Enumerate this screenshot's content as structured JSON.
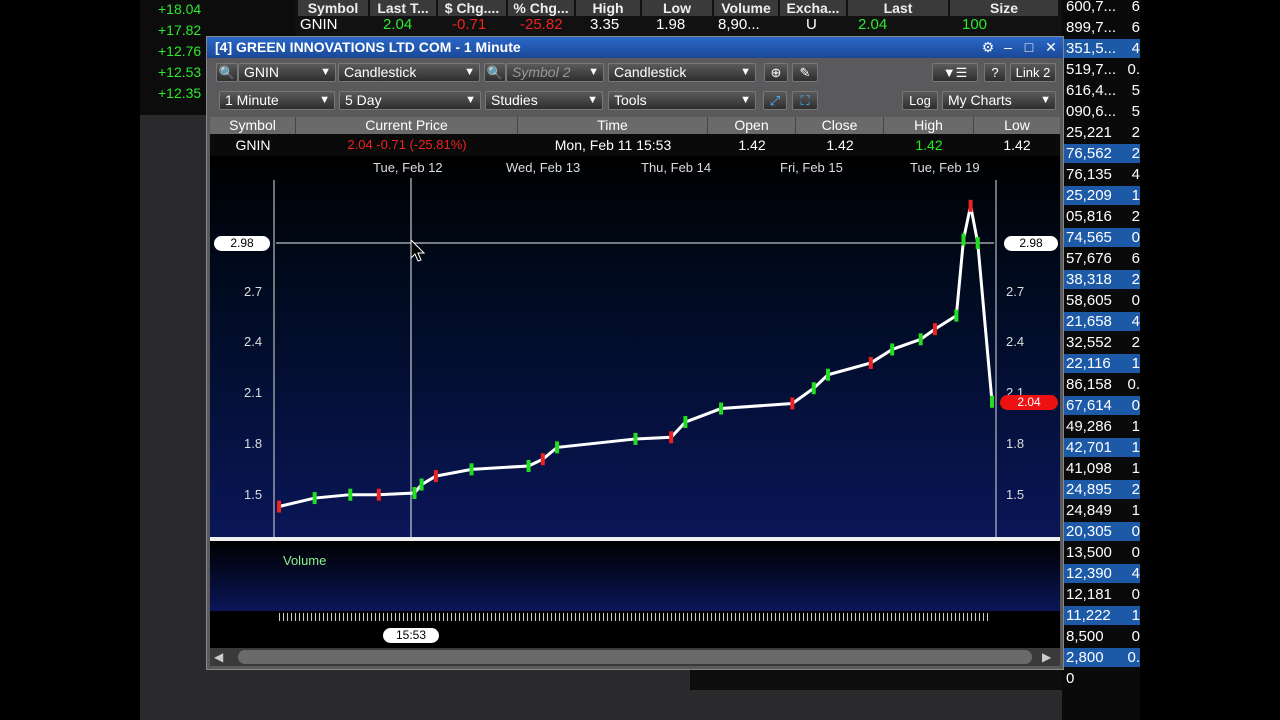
{
  "left_panel": {
    "values": [
      "+18.04",
      "+17.82",
      "+12.76",
      "+12.53",
      "+12.35"
    ]
  },
  "top_table": {
    "headers": [
      "Symbol",
      "Last T...",
      "$ Chg....",
      "% Chg...",
      "High",
      "Low",
      "Volume",
      "Excha...",
      "Last",
      "Size"
    ],
    "row": {
      "symbol": "GNIN",
      "last": "2.04",
      "chg": "-0.71",
      "pct": "-25.82",
      "high": "3.35",
      "low": "1.98",
      "volume": "8,90...",
      "exchange": "U",
      "last2": "2.04",
      "size": "100"
    }
  },
  "right_panel": {
    "rows": [
      {
        "n": "600,7...",
        "d": "6"
      },
      {
        "n": "899,7...",
        "d": "6"
      },
      {
        "n": "351,5...",
        "d": "4"
      },
      {
        "n": "519,7...",
        "d": "0."
      },
      {
        "n": "616,4...",
        "d": "5"
      },
      {
        "n": "090,6...",
        "d": "5"
      },
      {
        "n": "25,221",
        "d": "2"
      },
      {
        "n": "76,562",
        "d": "2"
      },
      {
        "n": "76,135",
        "d": "4"
      },
      {
        "n": "25,209",
        "d": "1"
      },
      {
        "n": "05,816",
        "d": "2"
      },
      {
        "n": "74,565",
        "d": "0"
      },
      {
        "n": "57,676",
        "d": "6"
      },
      {
        "n": "38,318",
        "d": "2"
      },
      {
        "n": "58,605",
        "d": "0"
      },
      {
        "n": "21,658",
        "d": "4"
      },
      {
        "n": "32,552",
        "d": "2"
      },
      {
        "n": "22,116",
        "d": "1"
      },
      {
        "n": "86,158",
        "d": "0."
      },
      {
        "n": "67,614",
        "d": "0"
      },
      {
        "n": "49,286",
        "d": "1"
      },
      {
        "n": "42,701",
        "d": "1"
      },
      {
        "n": "41,098",
        "d": "1"
      },
      {
        "n": "24,895",
        "d": "2"
      },
      {
        "n": "24,849",
        "d": "1"
      },
      {
        "n": "20,305",
        "d": "0"
      },
      {
        "n": "13,500",
        "d": "0"
      },
      {
        "n": "12,390",
        "d": "4"
      },
      {
        "n": "12,181",
        "d": "0"
      },
      {
        "n": "11,222",
        "d": "1"
      },
      {
        "n": "8,500",
        "d": "0"
      },
      {
        "n": "2,800",
        "d": "0."
      },
      {
        "n": "0",
        "d": ""
      }
    ]
  },
  "window": {
    "title": "[4] GREEN INNOVATIONS LTD COM - 1 Minute",
    "toolbar1": {
      "symbol": "GNIN",
      "chart_type": "Candlestick",
      "symbol2_placeholder": "Symbol 2",
      "chart_type2": "Candlestick",
      "link": "Link 2",
      "help": "?"
    },
    "toolbar2": {
      "interval": "1 Minute",
      "range": "5 Day",
      "studies": "Studies",
      "tools": "Tools",
      "log": "Log",
      "mycharts": "My Charts"
    },
    "quote": {
      "headers": [
        "Symbol",
        "Current Price",
        "Time",
        "Open",
        "Close",
        "High",
        "Low"
      ],
      "symbol": "GNIN",
      "current_price": "2.04  -0.71 (-25.81%)",
      "time": "Mon, Feb 11  15:53",
      "open": "1.42",
      "close": "1.42",
      "high": "1.42",
      "low": "1.42"
    },
    "dates": [
      "Tue, Feb 12",
      "Wed, Feb 13",
      "Thu, Feb 14",
      "Fri, Feb 15",
      "Tue, Feb 19"
    ],
    "price_ticks": [
      "2.7",
      "2.4",
      "2.1",
      "1.8",
      "1.5"
    ],
    "crosshair_price": "2.98",
    "last_price_badge": "2.04",
    "volume_label": "Volume",
    "crosshair_time": "15:53",
    "colors": {
      "up": "#22dd22",
      "down": "#ee2222",
      "badge": "#ee1111"
    }
  },
  "chart_data": {
    "type": "line",
    "title": "",
    "x": [
      "Tue, Feb 12",
      "Wed, Feb 13",
      "Thu, Feb 14",
      "Fri, Feb 15",
      "Tue, Feb 19"
    ],
    "ylim": [
      1.3,
      3.35
    ],
    "price_path": [
      [
        0,
        1.42
      ],
      [
        0.05,
        1.47
      ],
      [
        0.1,
        1.49
      ],
      [
        0.14,
        1.49
      ],
      [
        0.19,
        1.5
      ],
      [
        0.2,
        1.55
      ],
      [
        0.22,
        1.6
      ],
      [
        0.27,
        1.64
      ],
      [
        0.35,
        1.66
      ],
      [
        0.37,
        1.7
      ],
      [
        0.39,
        1.77
      ],
      [
        0.5,
        1.82
      ],
      [
        0.55,
        1.83
      ],
      [
        0.57,
        1.92
      ],
      [
        0.62,
        2.0
      ],
      [
        0.72,
        2.03
      ],
      [
        0.75,
        2.12
      ],
      [
        0.77,
        2.2
      ],
      [
        0.83,
        2.27
      ],
      [
        0.86,
        2.35
      ],
      [
        0.9,
        2.41
      ],
      [
        0.92,
        2.47
      ],
      [
        0.95,
        2.55
      ],
      [
        0.96,
        3.0
      ],
      [
        0.97,
        3.2
      ],
      [
        0.98,
        2.98
      ],
      [
        1.0,
        2.04
      ]
    ],
    "volume": "spikes near end of period"
  }
}
